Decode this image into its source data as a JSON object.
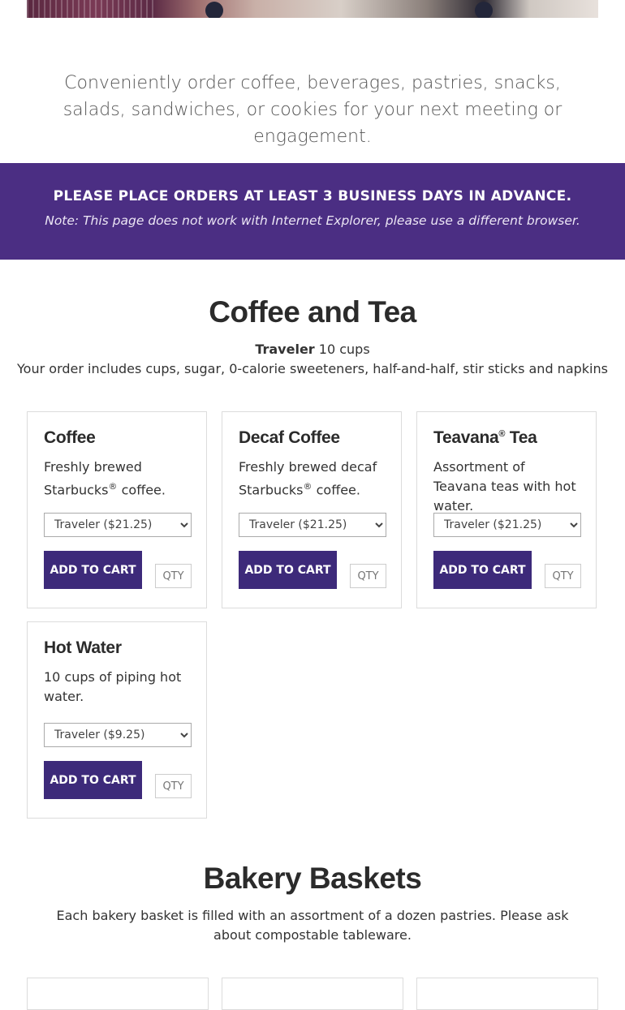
{
  "intro": {
    "text": "Conveniently order coffee, beverages, pastries, snacks, salads, sandwiches, or cookies for your next meeting or engagement."
  },
  "notice": {
    "title": "PLEASE PLACE ORDERS AT LEAST 3 BUSINESS DAYS IN ADVANCE.",
    "note": "Note: This page does not work with Internet Explorer, please use a different browser."
  },
  "coffee_section": {
    "title": "Coffee and Tea",
    "size_label": "Traveler",
    "size_detail": "10 cups",
    "includes": "Your order includes cups, sugar, 0-calorie sweeteners, half-and-half, stir sticks and napkins"
  },
  "products": [
    {
      "title": "Coffee",
      "desc_a": "Freshly brewed Starbucks",
      "desc_sup": "®",
      "desc_b": " coffee.",
      "option": "Traveler ($21.25)",
      "button": "ADD TO CART",
      "qty_placeholder": "QTY"
    },
    {
      "title": "Decaf Coffee",
      "desc_a": "Freshly brewed decaf Starbucks",
      "desc_sup": "®",
      "desc_b": " coffee.",
      "option": "Traveler ($21.25)",
      "button": "ADD TO CART",
      "qty_placeholder": "QTY"
    },
    {
      "title_a": "Teavana",
      "title_sup": "®",
      "title_b": " Tea",
      "desc": "Assortment of Teavana teas with hot water.",
      "option": "Traveler ($21.25)",
      "button": "ADD TO CART",
      "qty_placeholder": "QTY"
    },
    {
      "title": "Hot Water",
      "desc": "10 cups of piping hot water.",
      "option": "Traveler ($9.25)",
      "button": "ADD TO CART",
      "qty_placeholder": "QTY"
    }
  ],
  "bakery_section": {
    "title": "Bakery Baskets",
    "desc": "Each bakery basket is filled with an assortment of a dozen pastries. Please ask about compostable tableware."
  },
  "colors": {
    "accent": "#4b2e83",
    "button": "#3d2a7a"
  }
}
